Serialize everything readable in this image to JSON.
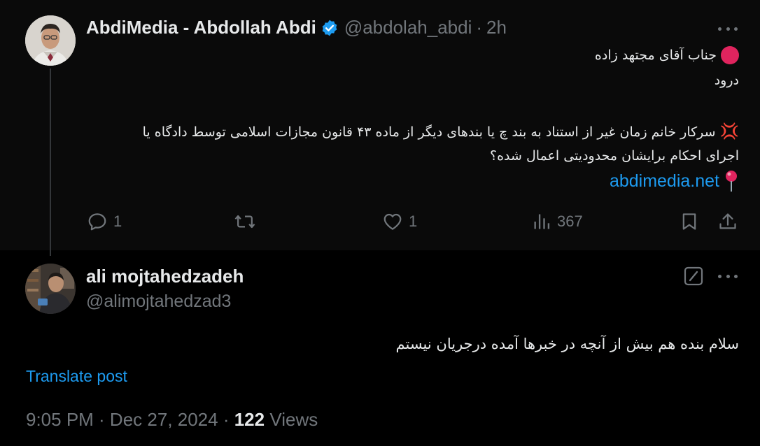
{
  "parent_post": {
    "author_name": "AbdiMedia - Abdollah Abdi",
    "handle": "@abdolah_abdi",
    "separator": "·",
    "time": "2h",
    "lines": [
      "جناب آقای مجتهد زاده",
      "درود",
      "سرکار خانم زمان غیر از استناد به بند چ یا بندهای دیگر از ماده ۴۳ قانون مجازات اسلامی توسط دادگاه یا",
      "اجرای احکام برایشان محدودیتی اعمال شده؟"
    ],
    "link": "abdimedia.net",
    "actions": {
      "replies": "1",
      "retweets": "",
      "likes": "1",
      "views": "367"
    },
    "colors": {
      "verified": "#1d9bf0",
      "red_dot": "#e0245e"
    }
  },
  "reply_post": {
    "author_name": "ali mojtahedzadeh",
    "handle": "@alimojtahedzad3",
    "text": "سلام بنده هم بیش از آنچه در خبرها آمده درجریان نیستم",
    "translate_label": "Translate post",
    "timestamp": "9:05 PM · Dec 27, 2024 ·",
    "views_count": "122",
    "views_label": "Views"
  },
  "colors": {
    "accent": "#1d9bf0",
    "muted": "#71767b",
    "text": "#e7e9ea",
    "background": "#000000"
  }
}
